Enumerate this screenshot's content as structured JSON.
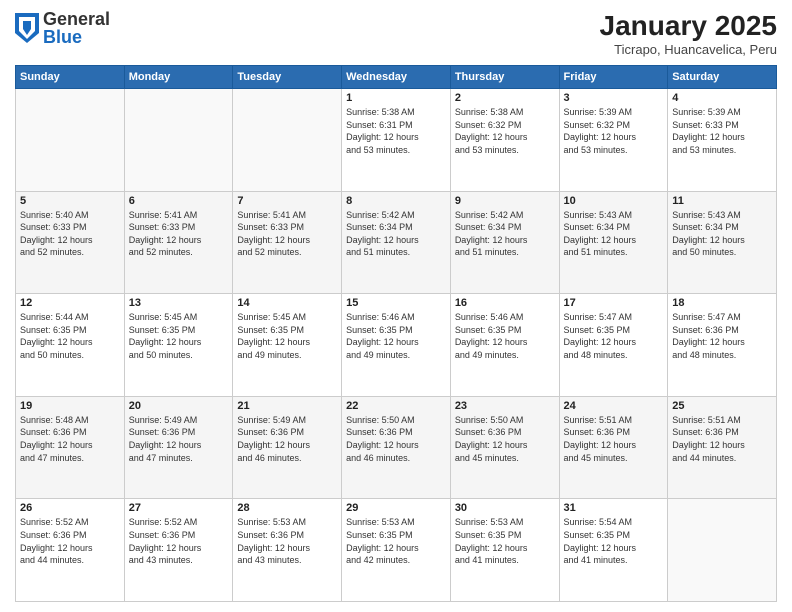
{
  "header": {
    "logo_general": "General",
    "logo_blue": "Blue",
    "month_title": "January 2025",
    "location": "Ticrapo, Huancavelica, Peru"
  },
  "weekdays": [
    "Sunday",
    "Monday",
    "Tuesday",
    "Wednesday",
    "Thursday",
    "Friday",
    "Saturday"
  ],
  "weeks": [
    [
      {
        "day": "",
        "info": ""
      },
      {
        "day": "",
        "info": ""
      },
      {
        "day": "",
        "info": ""
      },
      {
        "day": "1",
        "info": "Sunrise: 5:38 AM\nSunset: 6:31 PM\nDaylight: 12 hours\nand 53 minutes."
      },
      {
        "day": "2",
        "info": "Sunrise: 5:38 AM\nSunset: 6:32 PM\nDaylight: 12 hours\nand 53 minutes."
      },
      {
        "day": "3",
        "info": "Sunrise: 5:39 AM\nSunset: 6:32 PM\nDaylight: 12 hours\nand 53 minutes."
      },
      {
        "day": "4",
        "info": "Sunrise: 5:39 AM\nSunset: 6:33 PM\nDaylight: 12 hours\nand 53 minutes."
      }
    ],
    [
      {
        "day": "5",
        "info": "Sunrise: 5:40 AM\nSunset: 6:33 PM\nDaylight: 12 hours\nand 52 minutes."
      },
      {
        "day": "6",
        "info": "Sunrise: 5:41 AM\nSunset: 6:33 PM\nDaylight: 12 hours\nand 52 minutes."
      },
      {
        "day": "7",
        "info": "Sunrise: 5:41 AM\nSunset: 6:33 PM\nDaylight: 12 hours\nand 52 minutes."
      },
      {
        "day": "8",
        "info": "Sunrise: 5:42 AM\nSunset: 6:34 PM\nDaylight: 12 hours\nand 51 minutes."
      },
      {
        "day": "9",
        "info": "Sunrise: 5:42 AM\nSunset: 6:34 PM\nDaylight: 12 hours\nand 51 minutes."
      },
      {
        "day": "10",
        "info": "Sunrise: 5:43 AM\nSunset: 6:34 PM\nDaylight: 12 hours\nand 51 minutes."
      },
      {
        "day": "11",
        "info": "Sunrise: 5:43 AM\nSunset: 6:34 PM\nDaylight: 12 hours\nand 50 minutes."
      }
    ],
    [
      {
        "day": "12",
        "info": "Sunrise: 5:44 AM\nSunset: 6:35 PM\nDaylight: 12 hours\nand 50 minutes."
      },
      {
        "day": "13",
        "info": "Sunrise: 5:45 AM\nSunset: 6:35 PM\nDaylight: 12 hours\nand 50 minutes."
      },
      {
        "day": "14",
        "info": "Sunrise: 5:45 AM\nSunset: 6:35 PM\nDaylight: 12 hours\nand 49 minutes."
      },
      {
        "day": "15",
        "info": "Sunrise: 5:46 AM\nSunset: 6:35 PM\nDaylight: 12 hours\nand 49 minutes."
      },
      {
        "day": "16",
        "info": "Sunrise: 5:46 AM\nSunset: 6:35 PM\nDaylight: 12 hours\nand 49 minutes."
      },
      {
        "day": "17",
        "info": "Sunrise: 5:47 AM\nSunset: 6:35 PM\nDaylight: 12 hours\nand 48 minutes."
      },
      {
        "day": "18",
        "info": "Sunrise: 5:47 AM\nSunset: 6:36 PM\nDaylight: 12 hours\nand 48 minutes."
      }
    ],
    [
      {
        "day": "19",
        "info": "Sunrise: 5:48 AM\nSunset: 6:36 PM\nDaylight: 12 hours\nand 47 minutes."
      },
      {
        "day": "20",
        "info": "Sunrise: 5:49 AM\nSunset: 6:36 PM\nDaylight: 12 hours\nand 47 minutes."
      },
      {
        "day": "21",
        "info": "Sunrise: 5:49 AM\nSunset: 6:36 PM\nDaylight: 12 hours\nand 46 minutes."
      },
      {
        "day": "22",
        "info": "Sunrise: 5:50 AM\nSunset: 6:36 PM\nDaylight: 12 hours\nand 46 minutes."
      },
      {
        "day": "23",
        "info": "Sunrise: 5:50 AM\nSunset: 6:36 PM\nDaylight: 12 hours\nand 45 minutes."
      },
      {
        "day": "24",
        "info": "Sunrise: 5:51 AM\nSunset: 6:36 PM\nDaylight: 12 hours\nand 45 minutes."
      },
      {
        "day": "25",
        "info": "Sunrise: 5:51 AM\nSunset: 6:36 PM\nDaylight: 12 hours\nand 44 minutes."
      }
    ],
    [
      {
        "day": "26",
        "info": "Sunrise: 5:52 AM\nSunset: 6:36 PM\nDaylight: 12 hours\nand 44 minutes."
      },
      {
        "day": "27",
        "info": "Sunrise: 5:52 AM\nSunset: 6:36 PM\nDaylight: 12 hours\nand 43 minutes."
      },
      {
        "day": "28",
        "info": "Sunrise: 5:53 AM\nSunset: 6:36 PM\nDaylight: 12 hours\nand 43 minutes."
      },
      {
        "day": "29",
        "info": "Sunrise: 5:53 AM\nSunset: 6:35 PM\nDaylight: 12 hours\nand 42 minutes."
      },
      {
        "day": "30",
        "info": "Sunrise: 5:53 AM\nSunset: 6:35 PM\nDaylight: 12 hours\nand 41 minutes."
      },
      {
        "day": "31",
        "info": "Sunrise: 5:54 AM\nSunset: 6:35 PM\nDaylight: 12 hours\nand 41 minutes."
      },
      {
        "day": "",
        "info": ""
      }
    ]
  ]
}
